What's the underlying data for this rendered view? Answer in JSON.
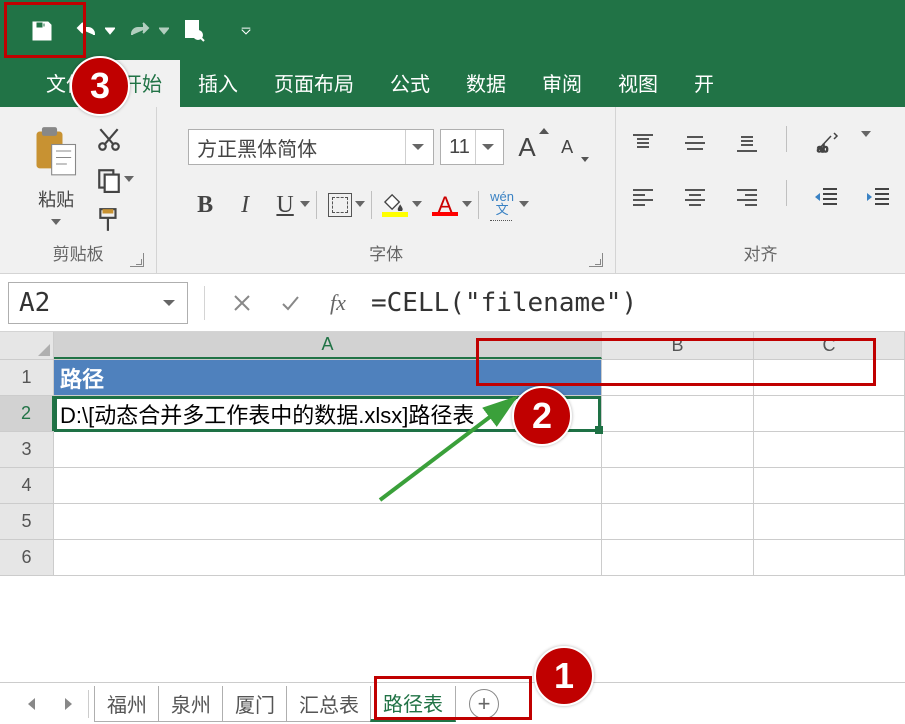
{
  "qat": {
    "save": "save-icon",
    "undo": "undo-icon",
    "redo": "redo-icon",
    "preview": "print-preview-icon",
    "customize": "customize-icon"
  },
  "tabs": {
    "file": "文件",
    "home": "开始",
    "insert": "插入",
    "layout": "页面布局",
    "formula": "公式",
    "data": "数据",
    "review": "审阅",
    "view": "视图",
    "extra": "开"
  },
  "ribbon": {
    "clipboard": {
      "paste": "粘贴",
      "label": "剪贴板"
    },
    "font": {
      "name": "方正黑体简体",
      "size": "11",
      "label": "字体",
      "bold": "B",
      "italic": "I",
      "underline": "U",
      "A_label": "A",
      "fontcolor_glyph": "A",
      "wen": "wén\n文"
    },
    "align": {
      "label": "对齐"
    }
  },
  "formula_bar": {
    "name_box": "A2",
    "fx": "fx",
    "formula": "=CELL(\"filename\")"
  },
  "grid": {
    "cols": {
      "A": "A",
      "B": "B",
      "C": "C"
    },
    "rows": [
      "1",
      "2",
      "3",
      "4",
      "5",
      "6"
    ],
    "A1": "路径",
    "A2": "D:\\[动态合并多工作表中的数据.xlsx]路径表"
  },
  "sheets": {
    "s1": "福州",
    "s2": "泉州",
    "s3": "厦门",
    "s4": "汇总表",
    "s5": "路径表",
    "new": "+"
  },
  "ann": {
    "n1": "1",
    "n2": "2",
    "n3": "3"
  }
}
